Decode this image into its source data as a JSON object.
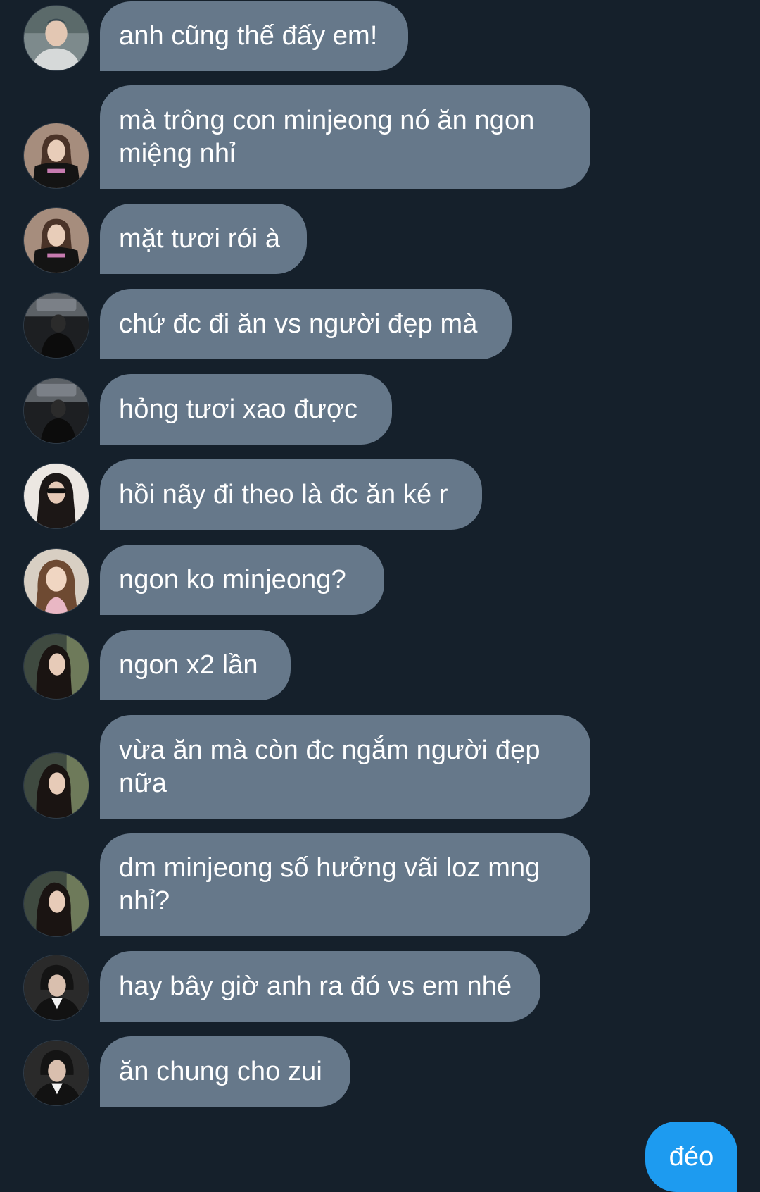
{
  "conversation": {
    "colors": {
      "background": "#15202b",
      "received_bubble": "#66788a",
      "sent_bubble": "#1d9bf0",
      "text": "#ffffff"
    },
    "messages": [
      {
        "sender": "other",
        "avatar": "avatar-gray-hoodie-guy",
        "text": "anh cũng thế đấy em!"
      },
      {
        "sender": "other",
        "avatar": "avatar-girl-black-crop-top",
        "text": "mà trông con minjeong nó ăn ngon miệng nhỉ"
      },
      {
        "sender": "other",
        "avatar": "avatar-girl-black-crop-top",
        "text": "mặt tươi rói à"
      },
      {
        "sender": "other",
        "avatar": "avatar-guy-dark-elevator",
        "text": "chứ đc đi ăn vs người đẹp mà"
      },
      {
        "sender": "other",
        "avatar": "avatar-guy-dark-elevator",
        "text": "hỏng tươi xao được"
      },
      {
        "sender": "other",
        "avatar": "avatar-girl-sunglasses",
        "text": "hồi nãy đi theo là đc ăn ké r"
      },
      {
        "sender": "other",
        "avatar": "avatar-girl-light-portrait",
        "text": "ngon ko minjeong?"
      },
      {
        "sender": "other",
        "avatar": "avatar-girl-long-dark-hair",
        "text": "ngon x2 lần"
      },
      {
        "sender": "other",
        "avatar": "avatar-girl-long-dark-hair",
        "text": "vừa ăn mà còn đc ngắm người đẹp nữa"
      },
      {
        "sender": "other",
        "avatar": "avatar-girl-long-dark-hair",
        "text": "dm minjeong số hưởng vãi loz mng nhỉ?"
      },
      {
        "sender": "other",
        "avatar": "avatar-guy-white-collar",
        "text": "hay bây giờ anh ra đó vs em nhé"
      },
      {
        "sender": "other",
        "avatar": "avatar-guy-white-collar",
        "text": "ăn chung cho zui"
      },
      {
        "sender": "me",
        "text": "đéo"
      }
    ]
  }
}
